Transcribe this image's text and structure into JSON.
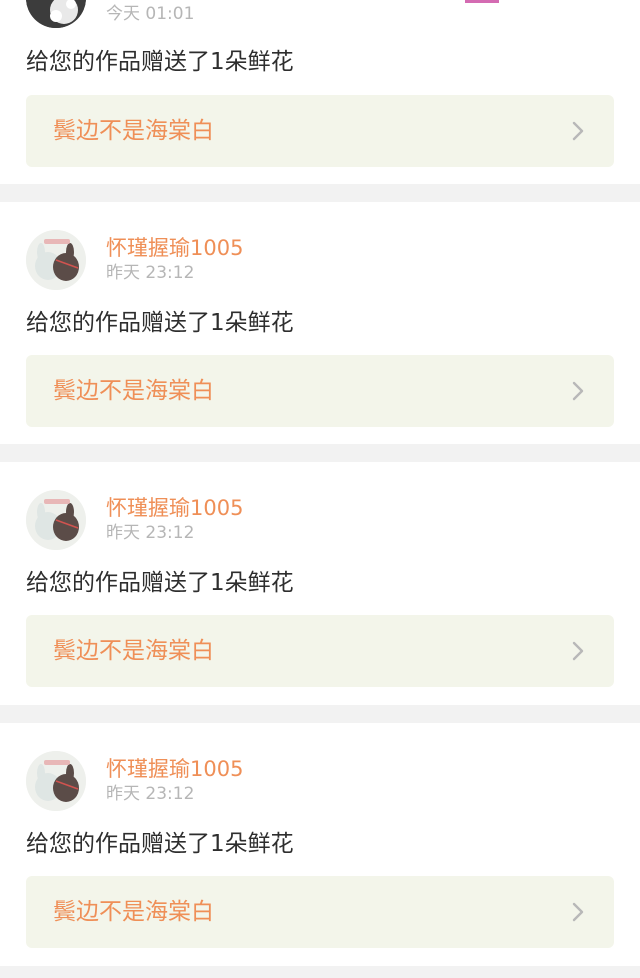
{
  "notifications": [
    {
      "user_name": "",
      "time": "今天 01:01",
      "message": "给您的作品赠送了1朵鲜花",
      "work_title": "鬓边不是海棠白"
    },
    {
      "user_name": "怀瑾握瑜1005",
      "time": "昨天 23:12",
      "message": "给您的作品赠送了1朵鲜花",
      "work_title": "鬓边不是海棠白"
    },
    {
      "user_name": "怀瑾握瑜1005",
      "time": "昨天 23:12",
      "message": "给您的作品赠送了1朵鲜花",
      "work_title": "鬓边不是海棠白"
    },
    {
      "user_name": "怀瑾握瑜1005",
      "time": "昨天 23:12",
      "message": "给您的作品赠送了1朵鲜花",
      "work_title": "鬓边不是海棠白"
    }
  ],
  "colors": {
    "accent": "#ef8f57",
    "link_background": "#f3f5ea",
    "page_background": "#f2f2f2",
    "timestamp": "#b6b6b6"
  },
  "icons": {
    "link_arrow": "chevron-right-icon",
    "avatar_bunny": "bunny-avatar-icon"
  }
}
